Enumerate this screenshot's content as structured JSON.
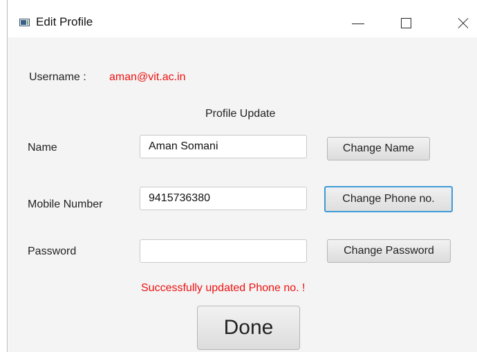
{
  "window": {
    "title": "Edit Profile",
    "icon": "app-window-icon",
    "controls": {
      "minimize": "minimize-icon",
      "maximize": "maximize-icon",
      "close": "close-icon"
    }
  },
  "user": {
    "label": "Username :",
    "value": "aman@vit.ac.in"
  },
  "form": {
    "heading": "Profile Update",
    "name": {
      "label": "Name",
      "value": "Aman Somani",
      "button": "Change Name"
    },
    "mobile": {
      "label": "Mobile Number",
      "value": "9415736380",
      "button": "Change Phone no."
    },
    "password": {
      "label": "Password",
      "value": "",
      "button": "Change Password"
    },
    "status_message": "Successfully updated Phone no. !",
    "done_label": "Done"
  },
  "colors": {
    "accent_red": "#ee1111",
    "focus_blue": "#3d9ad8"
  }
}
